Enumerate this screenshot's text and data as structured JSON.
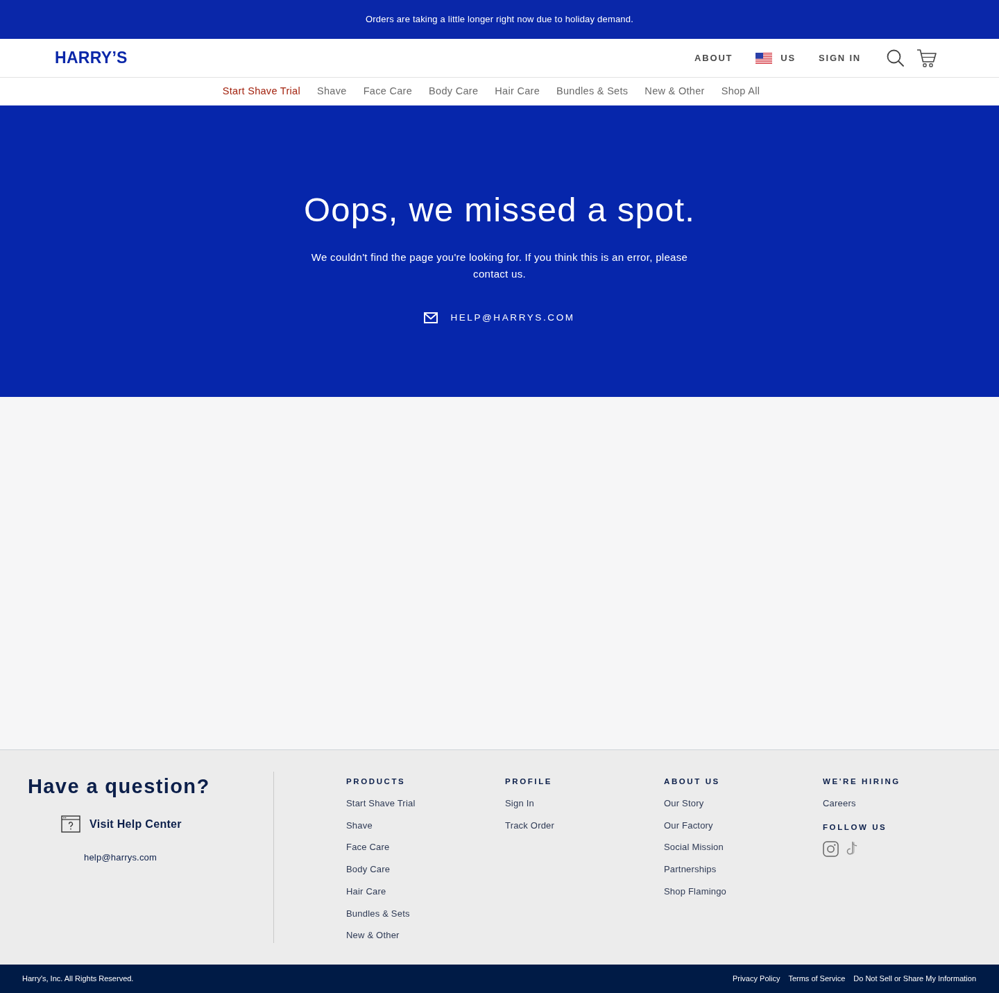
{
  "announcement": {
    "text": "Orders are taking a little longer right now due to holiday demand."
  },
  "header": {
    "logo": "HARRY’S",
    "about": "ABOUT",
    "region": "US",
    "sign_in": "SIGN IN"
  },
  "nav": [
    {
      "label": "Start Shave Trial",
      "selected": true
    },
    {
      "label": "Shave",
      "selected": false
    },
    {
      "label": "Face Care",
      "selected": false
    },
    {
      "label": "Body Care",
      "selected": false
    },
    {
      "label": "Hair Care",
      "selected": false
    },
    {
      "label": "Bundles & Sets",
      "selected": false
    },
    {
      "label": "New & Other",
      "selected": false
    },
    {
      "label": "Shop All",
      "selected": false
    }
  ],
  "hero": {
    "title": "Oops, we missed a spot.",
    "message": "We couldn't find the page you're looking for. If you think this is an error, please contact us.",
    "email": "HELP@HARRYS.COM"
  },
  "footer": {
    "help": {
      "title": "Have a question?",
      "link": "Visit Help Center",
      "email": "help@harrys.com"
    },
    "columns": [
      {
        "sections": [
          {
            "kind": "links",
            "heading": "PRODUCTS",
            "links": [
              "Start Shave Trial",
              "Shave",
              "Face Care",
              "Body Care",
              "Hair Care",
              "Bundles & Sets",
              "New & Other"
            ]
          }
        ]
      },
      {
        "sections": [
          {
            "kind": "links",
            "heading": "PROFILE",
            "links": [
              "Sign In",
              "Track Order"
            ]
          }
        ]
      },
      {
        "sections": [
          {
            "kind": "links",
            "heading": "ABOUT US",
            "links": [
              "Our Story",
              "Our Factory",
              "Social Mission",
              "Partnerships",
              "Shop Flamingo"
            ]
          }
        ]
      },
      {
        "sections": [
          {
            "kind": "links",
            "heading": "WE'RE HIRING",
            "links": [
              "Careers"
            ]
          },
          {
            "kind": "social",
            "heading": "FOLLOW US"
          }
        ]
      }
    ]
  },
  "legal": {
    "copyright": "Harry's, Inc. All Rights Reserved.",
    "links": [
      "Privacy Policy",
      "Terms of Service",
      "Do Not Sell or Share My Information"
    ]
  }
}
